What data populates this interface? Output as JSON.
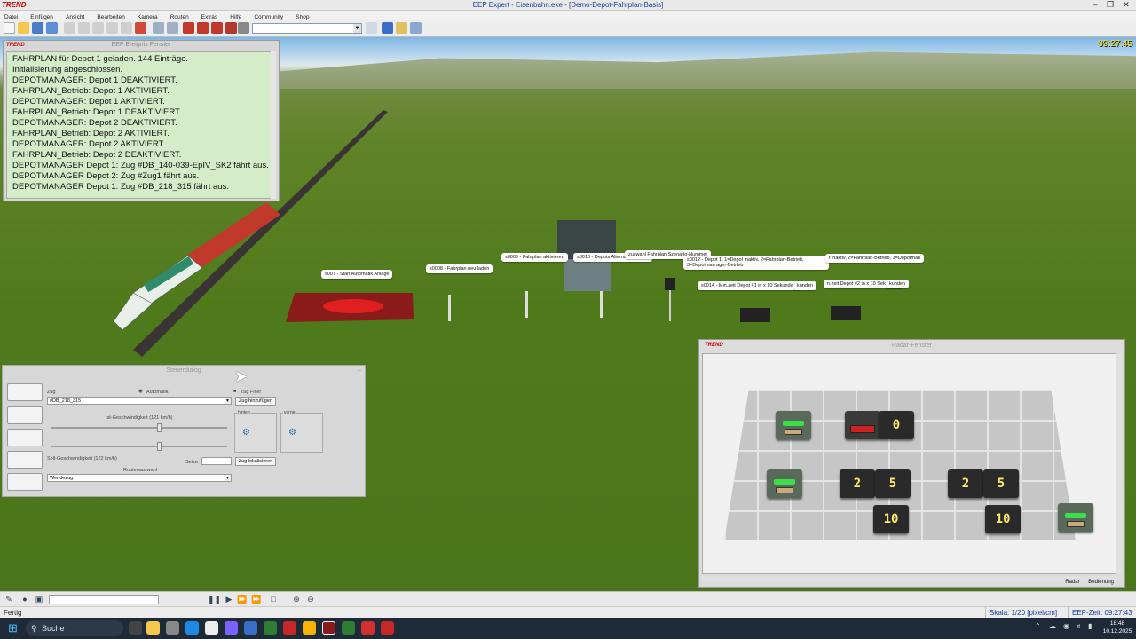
{
  "window": {
    "logo": "TREND",
    "title": "EEP Expert - Eisenbahn.exe - [Demo-Depot-Fahrplan-Basis]"
  },
  "menu": [
    "Datei",
    "Einfügen",
    "Ansicht",
    "Bearbeiten",
    "Kamera",
    "Routen",
    "Extras",
    "Hilfe",
    "Community",
    "Shop"
  ],
  "scene": {
    "clock": "09:27:45",
    "labels": [
      "s007 - Start Automatik Anlage",
      "s0008 - Fahrplan neu laden",
      "s0009 - Fahrplan aktivieren",
      "s0010 - Depots Alternativ-Betrieb",
      "zuswahl Fahrplan Szenario-Nummer",
      "s0012 - Depot 1, 1=Depot inaktiv, 2=Fahrplan-Betrieb, 3=Depotman ager-Betrieb",
      "t inaktiv, 2=Fahrplan-Betrieb, 3=Depotman",
      "s0014 - Min.zeit Depot #1 in x 10 Sekunden",
      "kunden",
      "n.zeit Depot #2 in x 10 Sekunden",
      "kunden"
    ]
  },
  "event_window": {
    "logo": "TREND",
    "title": "EEP Ereignis Fenster",
    "lines": [
      "FAHRPLAN für Depot 1 geladen. 144 Einträge.",
      "Initialisierung abgeschlossen.",
      "DEPOTMANAGER: Depot 1 DEAKTIVIERT.",
      "FAHRPLAN_Betrieb: Depot 1 AKTIVIERT.",
      "DEPOTMANAGER: Depot 1 AKTIVIERT.",
      "FAHRPLAN_Betrieb: Depot 1 DEAKTIVIERT.",
      "DEPOTMANAGER: Depot 2 DEAKTIVIERT.",
      "FAHRPLAN_Betrieb: Depot 2 AKTIVIERT.",
      "DEPOTMANAGER: Depot 2 AKTIVIERT.",
      "FAHRPLAN_Betrieb: Depot 2 DEAKTIVIERT.",
      "DEPOTMANAGER Depot 1: Zug #DB_140-039-EpIV_SK2 fährt aus.",
      "DEPOTMANAGER Depot 2: Zug #Zug1 fährt aus.",
      "DEPOTMANAGER Depot 1: Zug #DB_218_315 fährt aus."
    ]
  },
  "control_dialog": {
    "title": "Steuerdialog",
    "zug_label": "Zug",
    "zug_value": "#DB_218_315",
    "automatik_label": "Automatik",
    "zug_filter_label": "Zug Filter",
    "zug_hinzufuegen": "Zug hinzufügen",
    "ist_speed_label": "Ist-Geschwindigkeit (121 km/h)",
    "soll_speed_label": "Soll-Geschwindigkeit (122 km/h)",
    "setze_label": "Setze:",
    "setze_value": "",
    "zug_lokalisieren": "Zug lokalisieren",
    "hinten_label": "hinten",
    "vorne_label": "vorne",
    "routen_label": "Routenauswahl",
    "routen_value": "Wendezug",
    "ist_speed_fraction": 0.6,
    "soll_speed_fraction": 0.6
  },
  "radar_window": {
    "logo": "TREND",
    "title": "Radar-Fenster",
    "tiles_text": [
      "0",
      "2",
      "5",
      "2",
      "5",
      "10",
      "10"
    ],
    "tab_radar": "Radar",
    "tab_bedienung": "Bedienung"
  },
  "status_bar": {
    "status": "Fertig",
    "skala": "Skala: 1/20 [pixel/cm]",
    "eep_zeit": "EEP-Zeit: 09:27:43"
  },
  "taskbar": {
    "search_placeholder": "Suche",
    "time": "18:48",
    "date": "10.12.2025"
  },
  "colors": {
    "event_bg": "#d5ecc8",
    "title_blue": "#1a3d9c",
    "clock_yellow": "#ffe000",
    "led_green": "#39e04a"
  }
}
